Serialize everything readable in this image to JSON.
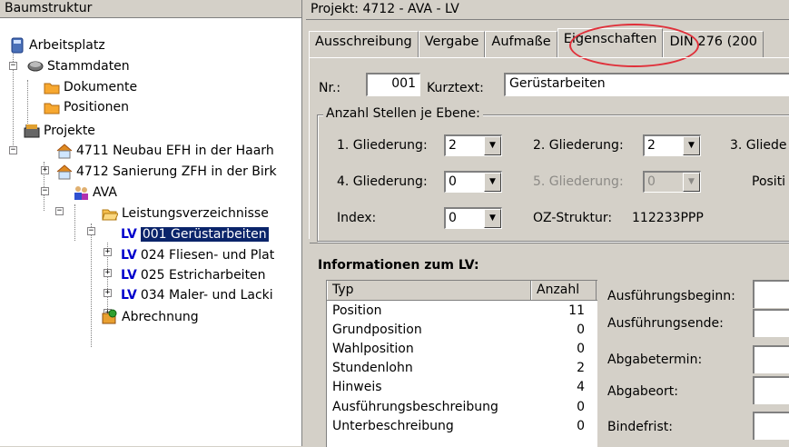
{
  "left_panel": {
    "header": "Baumstruktur",
    "tree": {
      "arbeitsplatz": "Arbeitsplatz",
      "stammdaten": "Stammdaten",
      "dokumente": "Dokumente",
      "positionen": "Positionen",
      "projekte": "Projekte",
      "p4711": "4711 Neubau EFH in der Haarh",
      "p4712": "4712 Sanierung ZFH in der Birk",
      "ava": "AVA",
      "leistungsverzeichnisse": "Leistungsverzeichnisse",
      "lv_tag": "LV",
      "lv001": "001 Gerüstarbeiten",
      "lv024": "024 Fliesen- und Plat",
      "lv025": "025 Estricharbeiten",
      "lv034": "034 Maler- und Lacki",
      "abrechnung": "Abrechnung"
    }
  },
  "right_panel": {
    "title": "Projekt: 4712 - AVA - LV",
    "tabs": [
      "Ausschreibung",
      "Vergabe",
      "Aufmaße",
      "Eigenschaften",
      "DIN 276 (200"
    ],
    "active_tab": "Eigenschaften",
    "nr_label": "Nr.:",
    "nr_value": "001",
    "kurztext_label": "Kurztext:",
    "kurztext_value": "Gerüstarbeiten",
    "group_label": "Anzahl Stellen je Ebene:",
    "g1_label": "1. Gliederung:",
    "g1_value": "2",
    "g2_label": "2. Gliederung:",
    "g2_value": "2",
    "g3_label": "3. Gliede",
    "g4_label": "4. Gliederung:",
    "g4_value": "0",
    "g5_label": "5. Gliederung:",
    "g5_value": "0",
    "posit_label": "Positi",
    "index_label": "Index:",
    "index_value": "0",
    "oz_label": "OZ-Struktur:",
    "oz_value": "112233PPP",
    "info_title": "Informationen zum LV:",
    "list_headers": [
      "Typ",
      "Anzahl"
    ],
    "list_rows": [
      {
        "typ": "Position",
        "anzahl": "11"
      },
      {
        "typ": "Grundposition",
        "anzahl": "0"
      },
      {
        "typ": "Wahlposition",
        "anzahl": "0"
      },
      {
        "typ": "Stundenlohn",
        "anzahl": "2"
      },
      {
        "typ": "Hinweis",
        "anzahl": "4"
      },
      {
        "typ": "Ausführungsbeschreibung",
        "anzahl": "0"
      },
      {
        "typ": "Unterbeschreibung",
        "anzahl": "0"
      }
    ],
    "dates": {
      "beginn": "Ausführungsbeginn:",
      "ende": "Ausführungsende:",
      "abgabetermin": "Abgabetermin:",
      "abgabeort": "Abgabeort:",
      "bindefrist": "Bindefrist:"
    }
  },
  "colors": {
    "selection": "#0a246a",
    "lv_tag": "#0000cc",
    "highlight_ring": "#e0303a",
    "window_bg": "#d4d0c8"
  }
}
